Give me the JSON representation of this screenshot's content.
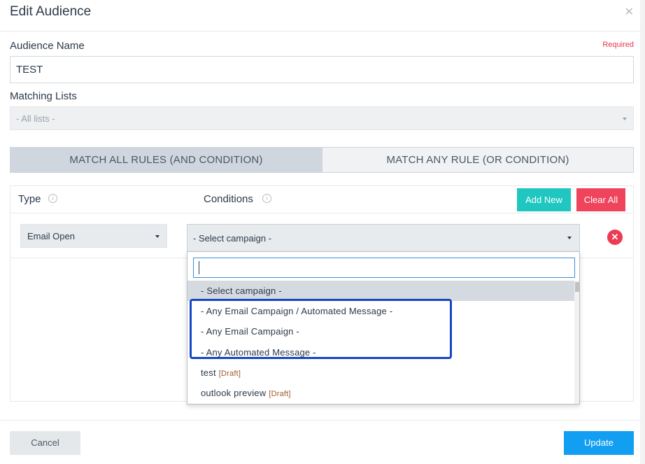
{
  "modal": {
    "title": "Edit Audience",
    "close_icon": "close-icon"
  },
  "form": {
    "audience_name_label": "Audience Name",
    "required_label": "Required",
    "audience_name_value": "TEST",
    "matching_lists_label": "Matching Lists",
    "matching_lists_value": "- All lists -"
  },
  "match_toggle": {
    "all_label": "MATCH ALL RULES (AND CONDITION)",
    "any_label": "MATCH ANY RULE (OR CONDITION)",
    "selected": "all"
  },
  "rules": {
    "type_header": "Type",
    "conditions_header": "Conditions",
    "add_new_label": "Add New",
    "clear_all_label": "Clear All",
    "row": {
      "type_value": "Email Open",
      "campaign_value": "- Select campaign -"
    }
  },
  "dropdown": {
    "search_value": "",
    "options": [
      {
        "label": "- Select campaign -",
        "tag": ""
      },
      {
        "label": "- Any Email Campaign / Automated Message -",
        "tag": ""
      },
      {
        "label": "- Any Email Campaign -",
        "tag": ""
      },
      {
        "label": "- Any Automated Message -",
        "tag": ""
      },
      {
        "label": "test",
        "tag": "[Draft]"
      },
      {
        "label": "outlook preview",
        "tag": "[Draft]"
      }
    ]
  },
  "footer": {
    "cancel_label": "Cancel",
    "update_label": "Update"
  },
  "colors": {
    "accent_teal": "#1fc7c0",
    "danger": "#f0435c",
    "primary_blue": "#129ef1",
    "highlight_box": "#1447c5"
  }
}
